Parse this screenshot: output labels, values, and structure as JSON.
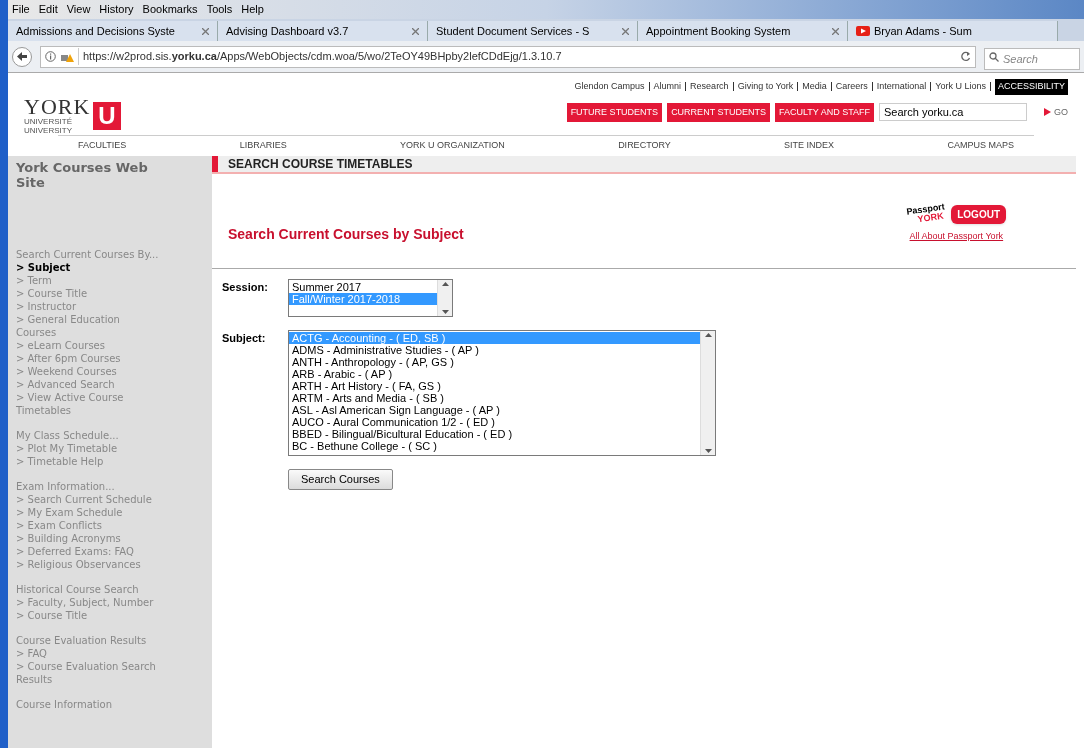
{
  "browser": {
    "menu": [
      "File",
      "Edit",
      "View",
      "History",
      "Bookmarks",
      "Tools",
      "Help"
    ],
    "tabs": [
      {
        "title": "Admissions and Decisions Syste",
        "kind": "plain"
      },
      {
        "title": "Advising Dashboard v3.7",
        "kind": "plain"
      },
      {
        "title": "Student Document Services - S",
        "kind": "plain"
      },
      {
        "title": "Appointment Booking System",
        "kind": "plain"
      },
      {
        "title": "Bryan Adams - Sum",
        "kind": "video"
      }
    ],
    "url": "https://w2prod.sis.**yorku.ca**/Apps/WebObjects/cdm.woa/5/wo/2TeOY49BHpby2lefCDdEjg/1.3.10.7",
    "search_placeholder": "Search"
  },
  "header": {
    "logo": {
      "word": "YORK",
      "letter": "U",
      "line_1": "UNIVERSITÉ",
      "line_2": "UNIVERSITY"
    },
    "top_links": [
      "Glendon Campus",
      "Alumni",
      "Research",
      "Giving to York",
      "Media",
      "Careers",
      "International",
      "York U Lions"
    ],
    "accessibility": "ACCESSIBILITY",
    "red_buttons": [
      "FUTURE STUDENTS",
      "CURRENT STUDENTS",
      "FACULTY AND STAFF"
    ],
    "search_value": "Search yorku.ca",
    "go": "GO"
  },
  "nav": [
    "FACULTIES",
    "LIBRARIES",
    "YORK U ORGANIZATION",
    "DIRECTORY",
    "SITE INDEX",
    "CAMPUS MAPS"
  ],
  "sidebar": {
    "title": "York Courses Web Site",
    "sections": [
      {
        "heading": "Search Current Courses By...",
        "items": [
          {
            "label": "> Subject",
            "selected": true
          },
          {
            "label": "> Term",
            "selected": false
          },
          {
            "label": "> Course Title",
            "selected": false
          },
          {
            "label": "> Instructor",
            "selected": false
          },
          {
            "label": "> General Education Courses",
            "selected": false
          },
          {
            "label": "> eLearn Courses",
            "selected": false
          },
          {
            "label": "> After 6pm Courses",
            "selected": false
          },
          {
            "label": "> Weekend Courses",
            "selected": false
          },
          {
            "label": "> Advanced Search",
            "selected": false
          },
          {
            "label": "> View Active Course Timetables",
            "selected": false
          }
        ]
      },
      {
        "heading": "My Class Schedule...",
        "items": [
          {
            "label": "> Plot My Timetable",
            "selected": false
          },
          {
            "label": "> Timetable Help",
            "selected": false
          }
        ]
      },
      {
        "heading": "Exam Information...",
        "items": [
          {
            "label": "> Search Current Schedule",
            "selected": false
          },
          {
            "label": "> My Exam Schedule",
            "selected": false
          },
          {
            "label": "> Exam Conflicts",
            "selected": false
          },
          {
            "label": "> Building Acronyms",
            "selected": false
          },
          {
            "label": "> Deferred Exams: FAQ",
            "selected": false
          },
          {
            "label": "> Religious Observances",
            "selected": false
          }
        ]
      },
      {
        "heading": "Historical Course Search",
        "items": [
          {
            "label": "> Faculty, Subject, Number",
            "selected": false
          },
          {
            "label": "> Course Title",
            "selected": false
          }
        ]
      },
      {
        "heading": "Course Evaluation Results",
        "items": [
          {
            "label": "> FAQ",
            "selected": false
          },
          {
            "label": "> Course Evaluation Search Results",
            "selected": false
          }
        ]
      },
      {
        "heading": "Course Information"
      }
    ]
  },
  "main": {
    "banner": "SEARCH COURSE TIMETABLES",
    "title": "Search Current Courses by Subject",
    "passport": {
      "word_1": "Passport",
      "word_2": "YORK",
      "logout": "LOGOUT",
      "link": "All About Passport York"
    },
    "session": {
      "label": "Session:",
      "options": [
        {
          "label": "Summer 2017",
          "selected": false
        },
        {
          "label": "Fall/Winter 2017-2018",
          "selected": true
        }
      ]
    },
    "subject": {
      "label": "Subject:",
      "options": [
        {
          "label": "ACTG - Accounting - ( ED, SB )",
          "selected": true
        },
        {
          "label": "ADMS - Administrative Studies - ( AP )",
          "selected": false
        },
        {
          "label": "ANTH - Anthropology - ( AP, GS )",
          "selected": false
        },
        {
          "label": "ARB - Arabic - ( AP )",
          "selected": false
        },
        {
          "label": "ARTH - Art History - ( FA, GS )",
          "selected": false
        },
        {
          "label": "ARTM - Arts and Media - ( SB )",
          "selected": false
        },
        {
          "label": "ASL - Asl American Sign Language - ( AP )",
          "selected": false
        },
        {
          "label": "AUCO - Aural Communication 1/2 - ( ED )",
          "selected": false
        },
        {
          "label": "BBED - Bilingual/Bicultural Education - ( ED )",
          "selected": false
        },
        {
          "label": "BC - Bethune College - ( SC )",
          "selected": false
        }
      ]
    },
    "button": "Search Courses"
  }
}
